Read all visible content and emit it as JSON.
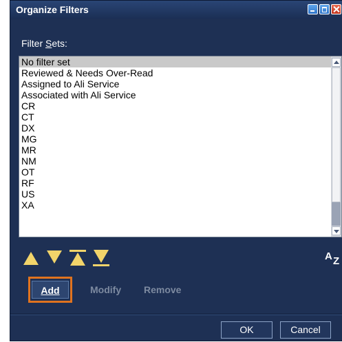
{
  "window": {
    "title": "Organize Filters"
  },
  "filter_sets": {
    "label": "Filter Sets:",
    "label_prefix": "Filter ",
    "label_mnemonic": "S",
    "label_suffix": "ets:",
    "items": [
      {
        "label": "No filter set",
        "selected": true
      },
      {
        "label": "Reviewed & Needs Over-Read",
        "selected": false
      },
      {
        "label": "Assigned to Ali Service",
        "selected": false
      },
      {
        "label": "Associated with Ali Service",
        "selected": false
      },
      {
        "label": "CR",
        "selected": false
      },
      {
        "label": "CT",
        "selected": false
      },
      {
        "label": "DX",
        "selected": false
      },
      {
        "label": "MG",
        "selected": false
      },
      {
        "label": "MR",
        "selected": false
      },
      {
        "label": "NM",
        "selected": false
      },
      {
        "label": "OT",
        "selected": false
      },
      {
        "label": "RF",
        "selected": false
      },
      {
        "label": "US",
        "selected": false
      },
      {
        "label": "XA",
        "selected": false
      }
    ]
  },
  "order_controls": {
    "icons": [
      "move-up-icon",
      "move-down-icon",
      "move-to-top-icon",
      "move-to-bottom-icon",
      "sort-alphabetical-icon"
    ],
    "color": "#f2d46a",
    "sort_a": "A",
    "sort_z": "Z"
  },
  "actions": {
    "add_label": "Add",
    "modify_label": "Modify",
    "remove_label": "Remove",
    "highlight_color": "#e0731f"
  },
  "dialog_buttons": {
    "ok_label": "OK",
    "cancel_label": "Cancel"
  },
  "colors": {
    "window_background": "#1e3054",
    "selection": "#c9c9c9",
    "disabled_text": "#7d8aa0"
  }
}
